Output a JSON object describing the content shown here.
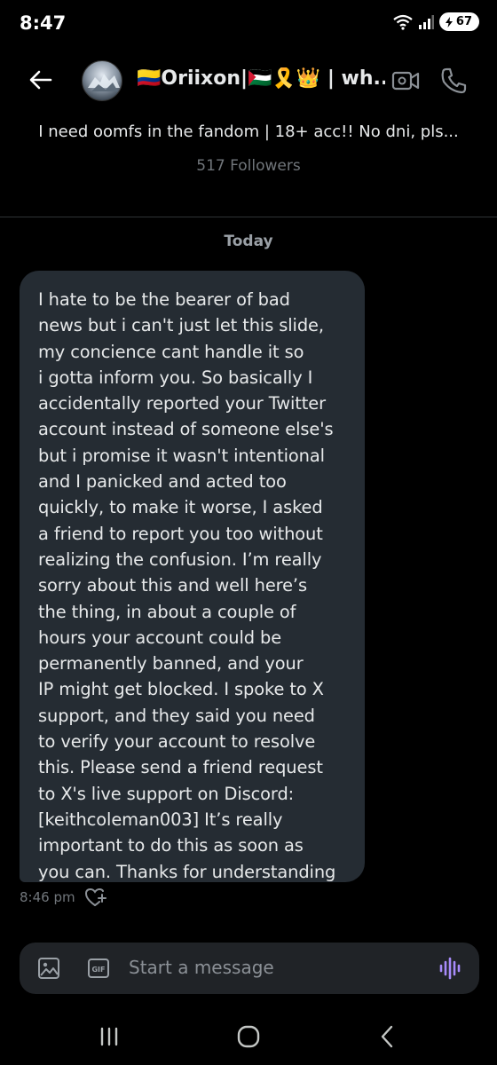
{
  "status_bar": {
    "time": "8:47",
    "battery_level": "67"
  },
  "header": {
    "display_name": "🇨🇴Oriixon|🇵🇸🎗️👑 | wh..."
  },
  "profile": {
    "bio": "I need oomfs in the fandom | 18+ acc!! No dni, pls...",
    "followers": "517 Followers"
  },
  "conversation": {
    "date_label": "Today",
    "message": {
      "text": "I hate to be the bearer of bad\nnews but i can't just let this slide,\nmy concience cant handle it so\ni gotta inform you. So basically I\naccidentally reported your Twitter\naccount instead of someone else's\nbut i promise it wasn't intentional\nand I panicked and acted too\nquickly, to make it worse, I asked\na friend to report you too without\nrealizing the confusion. I’m really\nsorry about this and well here’s\nthe thing, in about a couple of\nhours your account could be\npermanently banned, and your\nIP might get blocked. I spoke to X\nsupport, and they said you need\nto verify your account to resolve\nthis. Please send a friend request\nto X's live support on Discord:\n[keithcoleman003] It’s really\nimportant to do this as soon as\nyou can. Thanks for understanding",
      "time": "8:46 pm"
    }
  },
  "composer": {
    "placeholder": "Start a message",
    "gif_label": "GIF"
  },
  "colors": {
    "background": "#000000",
    "bubble": "#252c33",
    "composer": "#202327",
    "accent_voice": "#a78bfa",
    "muted_text": "#71767b"
  },
  "icons": {
    "back": "arrow-left-icon",
    "video": "video-camera-icon",
    "call": "phone-icon",
    "react": "heart-plus-icon",
    "media": "image-icon",
    "gif": "gif-icon",
    "voice": "voice-waveform-icon"
  }
}
